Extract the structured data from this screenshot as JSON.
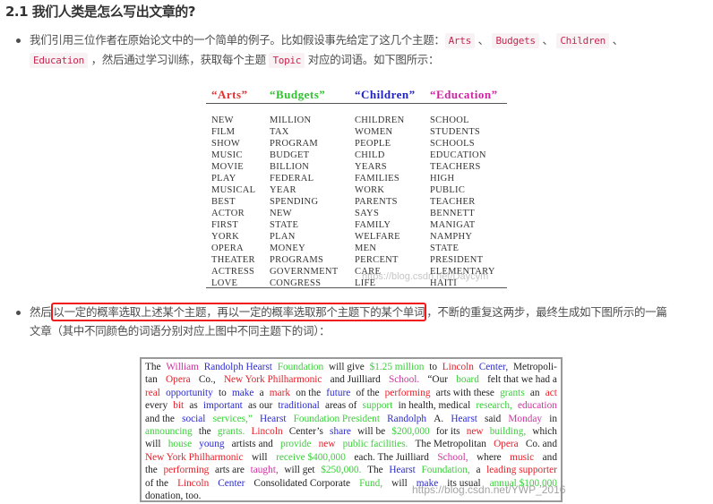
{
  "heading": "2.1 我们人类是怎么写出文章的?",
  "para1": {
    "text_a": "我们引用三位作者在原始论文中的一个简单的例子。比如假设事先给定了这几个主题：",
    "codes": [
      "Arts",
      "Budgets",
      "Children",
      "Education",
      "Topic"
    ],
    "sep": "、",
    "text_b": "，然后通过学习训练，获取每个主题",
    "text_c": "对应的词语。如下图所示："
  },
  "para2": {
    "text_a": "然后",
    "highlight": "以一定的概率选取上述某个主题，再以一定的概率选取那个主题下的某个单词",
    "text_b": "，不断的重复这两步，最终生成如下图所示的一篇",
    "text_c": "文章（其中不同颜色的词语分别对应上图中不同主题下的词）："
  },
  "colors": {
    "k": "#222222",
    "r": "#e8202a",
    "b": "#2a2ad0",
    "g": "#38d038",
    "m": "#d030a0",
    "highlight_box": "#f01818"
  },
  "table": {
    "headers": [
      {
        "label": "“Arts”",
        "color": "#e03030"
      },
      {
        "label": "“Budgets”",
        "color": "#30c030"
      },
      {
        "label": "“Children”",
        "color": "#2020c0"
      },
      {
        "label": "“Education”",
        "color": "#d020a0"
      }
    ],
    "columns": [
      [
        "NEW",
        "FILM",
        "SHOW",
        "MUSIC",
        "MOVIE",
        "PLAY",
        "MUSICAL",
        "BEST",
        "ACTOR",
        "FIRST",
        "YORK",
        "OPERA",
        "THEATER",
        "ACTRESS",
        "LOVE"
      ],
      [
        "MILLION",
        "TAX",
        "PROGRAM",
        "BUDGET",
        "BILLION",
        "FEDERAL",
        "YEAR",
        "SPENDING",
        "NEW",
        "STATE",
        "PLAN",
        "MONEY",
        "PROGRAMS",
        "GOVERNMENT",
        "CONGRESS"
      ],
      [
        "CHILDREN",
        "WOMEN",
        "PEOPLE",
        "CHILD",
        "YEARS",
        "FAMILIES",
        "WORK",
        "PARENTS",
        "SAYS",
        "FAMILY",
        "WELFARE",
        "MEN",
        "PERCENT",
        "CARE",
        "LIFE"
      ],
      [
        "SCHOOL",
        "STUDENTS",
        "SCHOOLS",
        "EDUCATION",
        "TEACHERS",
        "HIGH",
        "PUBLIC",
        "TEACHER",
        "BENNETT",
        "MANIGAT",
        "NAMPHY",
        "STATE",
        "PRESIDENT",
        "ELEMENTARY",
        "HAITI"
      ]
    ],
    "watermark": "https://blog.csdn.net/Daycym"
  },
  "passage": {
    "lines": [
      [
        [
          "The",
          "k"
        ],
        [
          "William",
          "m"
        ],
        [
          "Randolph Hearst",
          "b"
        ],
        [
          "Foundation",
          "g"
        ],
        [
          "will give",
          "k"
        ],
        [
          "$1.25 million",
          "g"
        ],
        [
          "to",
          "k"
        ],
        [
          "Lincoln",
          "r"
        ],
        [
          "Center,",
          "b"
        ],
        [
          "Metropoli-",
          "k"
        ]
      ],
      [
        [
          "tan",
          "k"
        ],
        [
          "Opera",
          "r"
        ],
        [
          "Co.,",
          "k"
        ],
        [
          "New York Philharmonic",
          "r"
        ],
        [
          "and Juilliard",
          "k"
        ],
        [
          "School.",
          "m"
        ],
        [
          "“Our",
          "k"
        ],
        [
          "board",
          "g"
        ],
        [
          "felt that we had a",
          "k"
        ]
      ],
      [
        [
          "real",
          "r"
        ],
        [
          "opportunity",
          "b"
        ],
        [
          "to",
          "k"
        ],
        [
          "make",
          "b"
        ],
        [
          "a",
          "k"
        ],
        [
          "mark",
          "r"
        ],
        [
          "on the",
          "k"
        ],
        [
          "future",
          "b"
        ],
        [
          "of the",
          "k"
        ],
        [
          "performing",
          "r"
        ],
        [
          "arts with these",
          "k"
        ],
        [
          "grants",
          "g"
        ],
        [
          "an",
          "k"
        ],
        [
          "act",
          "r"
        ]
      ],
      [
        [
          "every",
          "k"
        ],
        [
          "bit",
          "r"
        ],
        [
          "as",
          "k"
        ],
        [
          "important",
          "b"
        ],
        [
          "as our",
          "k"
        ],
        [
          "traditional",
          "b"
        ],
        [
          "areas of",
          "k"
        ],
        [
          "support",
          "g"
        ],
        [
          "in health, medical",
          "k"
        ],
        [
          "research,",
          "g"
        ],
        [
          "education",
          "m"
        ]
      ],
      [
        [
          "and the",
          "k"
        ],
        [
          "social",
          "b"
        ],
        [
          "services,”",
          "g"
        ],
        [
          "Hearst",
          "b"
        ],
        [
          "Foundation President",
          "g"
        ],
        [
          "Randolph",
          "b"
        ],
        [
          "A.",
          "k"
        ],
        [
          "Hearst",
          "b"
        ],
        [
          "said",
          "k"
        ],
        [
          "Monday",
          "m"
        ],
        [
          "in",
          "k"
        ]
      ],
      [
        [
          "announcing",
          "g"
        ],
        [
          "the",
          "k"
        ],
        [
          "grants.",
          "g"
        ],
        [
          "Lincoln",
          "r"
        ],
        [
          "Center’s",
          "k"
        ],
        [
          "share",
          "b"
        ],
        [
          "will be",
          "k"
        ],
        [
          "$200,000",
          "g"
        ],
        [
          "for its",
          "k"
        ],
        [
          "new",
          "r"
        ],
        [
          "building,",
          "g"
        ],
        [
          "which",
          "k"
        ]
      ],
      [
        [
          "will",
          "k"
        ],
        [
          "house",
          "g"
        ],
        [
          "young",
          "b"
        ],
        [
          "artists and",
          "k"
        ],
        [
          "provide",
          "g"
        ],
        [
          "new",
          "r"
        ],
        [
          "public facilities.",
          "g"
        ],
        [
          "The Metropolitan",
          "k"
        ],
        [
          "Opera",
          "r"
        ],
        [
          "Co. and",
          "k"
        ]
      ],
      [
        [
          "New York Philharmonic",
          "r"
        ],
        [
          "will",
          "k"
        ],
        [
          "receive $400,000",
          "g"
        ],
        [
          "each. The Juilliard",
          "k"
        ],
        [
          "School,",
          "m"
        ],
        [
          "where",
          "k"
        ],
        [
          "music",
          "r"
        ],
        [
          "and",
          "k"
        ]
      ],
      [
        [
          "the",
          "k"
        ],
        [
          "performing",
          "r"
        ],
        [
          "arts are",
          "k"
        ],
        [
          "taught,",
          "m"
        ],
        [
          "will get",
          "k"
        ],
        [
          "$250,000.",
          "g"
        ],
        [
          "The",
          "k"
        ],
        [
          "Hearst",
          "b"
        ],
        [
          "Foundation,",
          "g"
        ],
        [
          "a",
          "k"
        ],
        [
          "leading supporter",
          "r"
        ]
      ],
      [
        [
          "of the",
          "k"
        ],
        [
          "Lincoln",
          "r"
        ],
        [
          "Center",
          "b"
        ],
        [
          "Consolidated Corporate",
          "k"
        ],
        [
          "Fund,",
          "g"
        ],
        [
          "will",
          "k"
        ],
        [
          "make",
          "b"
        ],
        [
          "its usual",
          "k"
        ],
        [
          "annual $100,000",
          "g"
        ]
      ],
      [
        [
          "donation, too.",
          "k"
        ]
      ]
    ],
    "watermark": "https://blog.csdn.net/YWP_2016"
  }
}
